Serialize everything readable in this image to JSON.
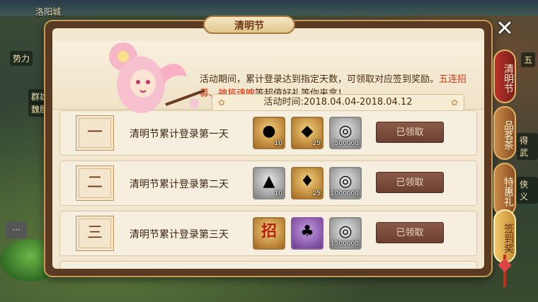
{
  "background": {
    "city_label": "洛阳城",
    "left_texts": [
      "势力",
      "群雄",
      "魏殷"
    ],
    "right_texts": [
      "五",
      "得武",
      "侠义"
    ]
  },
  "panel": {
    "title": "清明节",
    "description_prefix": "活动期间，累计登录达到指定天数，可领取对应签到奖励。",
    "description_highlight1": "五连招募、神将魂魄",
    "description_suffix": "等超值好礼等你来拿！",
    "time_label": "活动时间:",
    "time_range": "2018.04.04-2018.04.12"
  },
  "rows": [
    {
      "day": "一",
      "label": "清明节累计登录第一天",
      "items": [
        {
          "icon": "pearl-icon",
          "glyph": "●",
          "count": "10",
          "style": "gold"
        },
        {
          "icon": "gourd-icon",
          "glyph": "◆",
          "count": "25",
          "style": "gold"
        },
        {
          "icon": "silver-coin-icon",
          "glyph": "◎",
          "count": "500000",
          "style": "silver"
        }
      ],
      "button": "已领取"
    },
    {
      "day": "二",
      "label": "清明节累计登录第二天",
      "items": [
        {
          "icon": "iron-ingot-icon",
          "glyph": "▲",
          "count": "10",
          "style": "silver"
        },
        {
          "icon": "pouch-icon",
          "glyph": "♦",
          "count": "25",
          "style": "gold"
        },
        {
          "icon": "silver-coin-icon",
          "glyph": "◎",
          "count": "1000000",
          "style": "silver"
        }
      ],
      "button": "已领取"
    },
    {
      "day": "三",
      "label": "清明节累计登录第三天",
      "items": [
        {
          "icon": "recruit-token-icon",
          "glyph": "招",
          "count": "",
          "style": "gold"
        },
        {
          "icon": "soul-bag-icon",
          "glyph": "♣",
          "count": "",
          "style": "purple"
        },
        {
          "icon": "silver-coin-icon",
          "glyph": "◎",
          "count": "1500000",
          "style": "silver"
        }
      ],
      "button": "已领取"
    }
  ],
  "tabs": [
    {
      "label": "清明节"
    },
    {
      "label": "品茗茶"
    },
    {
      "label": "特惠礼"
    },
    {
      "label": "签到奖"
    }
  ],
  "close_glyph": "✕",
  "colors": {
    "highlight": "#e0320f",
    "button": "#7a4a3a",
    "frame": "#5b3a24"
  }
}
